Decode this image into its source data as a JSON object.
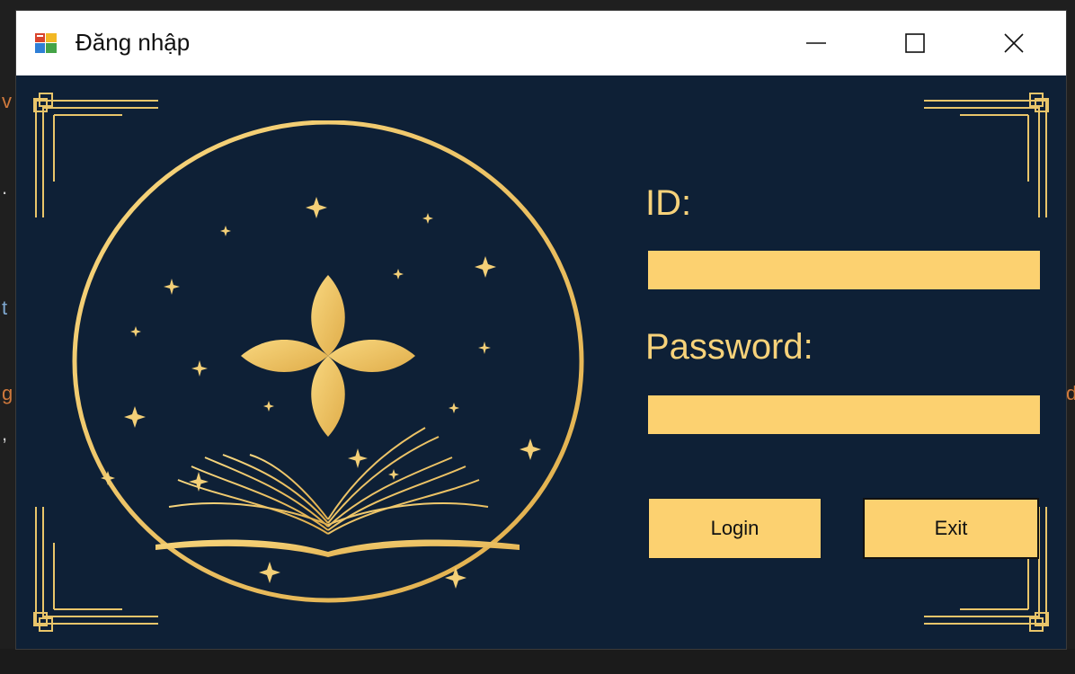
{
  "window": {
    "title": "Đăng nhập"
  },
  "titlebar": {
    "minimize_icon": "minimize-icon",
    "maximize_icon": "maximize-icon",
    "close_icon": "close-icon"
  },
  "form": {
    "id_label": "ID:",
    "id_value": "",
    "password_label": "Password:",
    "password_value": "",
    "login_button": "Login",
    "exit_button": "Exit"
  },
  "colors": {
    "accent": "#fcd170",
    "gold": "#f2c866",
    "background": "#0e2036",
    "label": "#f7d27a"
  },
  "icons": {
    "app": "app-form-icon",
    "emblem": "book-flower-emblem"
  }
}
